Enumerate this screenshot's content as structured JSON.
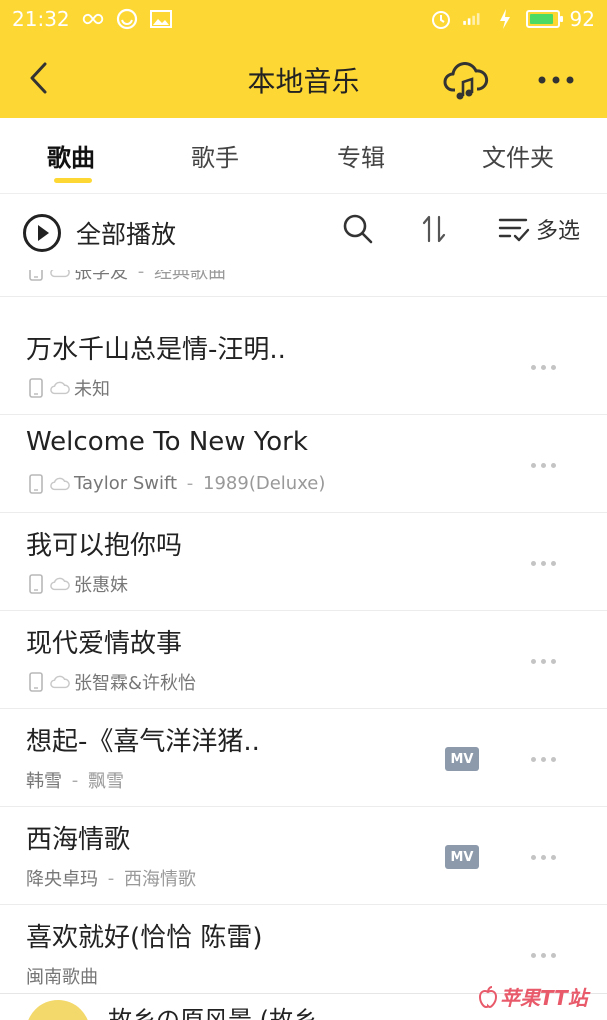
{
  "status": {
    "time": "21:32",
    "battery": "92",
    "battery_level": 0.92
  },
  "header": {
    "title": "本地音乐"
  },
  "tabs": [
    {
      "label": "歌曲",
      "active": true
    },
    {
      "label": "歌手",
      "active": false
    },
    {
      "label": "专辑",
      "active": false
    },
    {
      "label": "文件夹",
      "active": false
    }
  ],
  "actions": {
    "play_all": "全部播放",
    "multi_select": "多选"
  },
  "songs": [
    {
      "title": "",
      "artist": "张学友",
      "album": "经典歌曲",
      "local": true,
      "mv": false
    },
    {
      "title": "万水千山总是情-汪明..",
      "artist": "未知",
      "album": "",
      "local": true,
      "mv": false
    },
    {
      "title": "Welcome To New York",
      "artist": "Taylor Swift",
      "album": "1989(Deluxe)",
      "local": true,
      "mv": false
    },
    {
      "title": "我可以抱你吗",
      "artist": "张惠妹",
      "album": "",
      "local": true,
      "mv": false
    },
    {
      "title": "现代爱情故事",
      "artist": "张智霖&许秋怡",
      "album": "",
      "local": true,
      "mv": false
    },
    {
      "title": "想起-《喜气洋洋猪..",
      "artist": "韩雪",
      "album": "飘雪",
      "local": false,
      "mv": true
    },
    {
      "title": "西海情歌",
      "artist": "降央卓玛",
      "album": "西海情歌",
      "local": false,
      "mv": true
    },
    {
      "title": "喜欢就好(恰恰 陈雷)",
      "artist": "闽南歌曲",
      "album": "",
      "local": false,
      "mv": false
    }
  ],
  "mv_label": "MV",
  "separator": " - ",
  "miniplayer": {
    "title": "故乡の原风景 (故乡"
  },
  "watermark": "苹果TT站",
  "colors": {
    "brand_yellow": "#fdd835",
    "mv_badge": "#8c9aab"
  }
}
